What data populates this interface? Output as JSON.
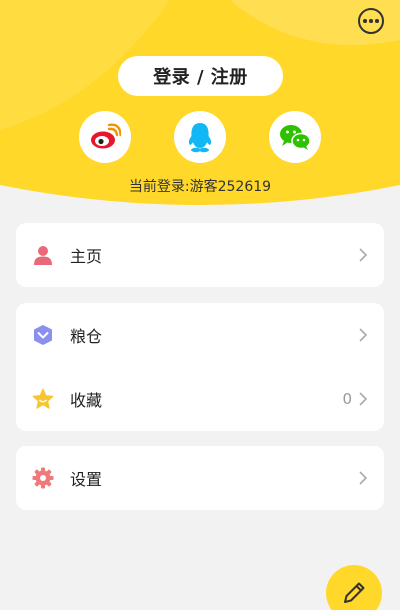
{
  "header": {
    "login_label": "登录 / 注册",
    "current_login": "当前登录:游客252619",
    "socials": [
      "weibo-icon",
      "qq-icon",
      "wechat-icon"
    ],
    "bg_color": "#ffd829"
  },
  "menu": {
    "home": {
      "label": "主页",
      "icon": "user-icon"
    },
    "granary": {
      "label": "粮仓",
      "icon": "shield-icon"
    },
    "favorites": {
      "label": "收藏",
      "count": "0",
      "icon": "star-icon"
    },
    "settings": {
      "label": "设置",
      "icon": "gear-icon"
    }
  },
  "fab": {
    "icon": "pencil-icon"
  }
}
